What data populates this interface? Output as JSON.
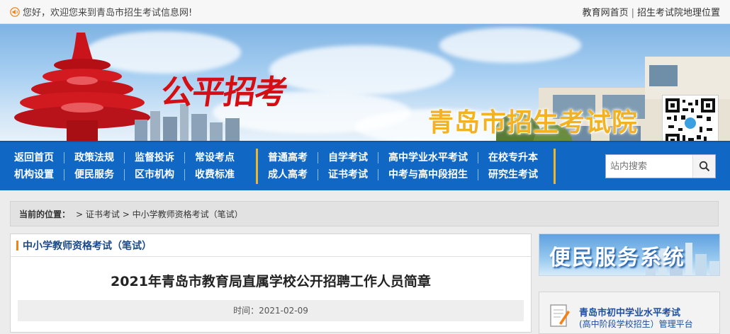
{
  "topbar": {
    "greeting": "您好，欢迎您来到青岛市招生考试信息网!",
    "link_home": "教育网首页",
    "separator": "|",
    "link_location": "招生考试院地理位置"
  },
  "banner": {
    "calligraphy": "公平招考",
    "title": "青岛市招生考试院"
  },
  "nav": {
    "group1": [
      "返回首页",
      "政策法规",
      "监督投诉",
      "常设考点",
      "机构设置",
      "便民服务",
      "区市机构",
      "收费标准"
    ],
    "group2": [
      "普通高考",
      "自学考试",
      "高中学业水平考试",
      "在校专升本",
      "成人高考",
      "证书考试",
      "中考与高中段招生",
      "研究生考试"
    ],
    "search_placeholder": "站内搜索"
  },
  "breadcrumb": {
    "label": "当前的位置：",
    "path": "> 证书考试 > 中小学教师资格考试（笔试）"
  },
  "article": {
    "section_title": "中小学教师资格考试（笔试）",
    "title": "2021年青岛市教育局直属学校公开招聘工作人员简章",
    "time": "时间：2021-02-09"
  },
  "sidebar": {
    "promo_title": "便民服务系统",
    "service_line1": "青岛市初中学业水平考试",
    "service_line2": "(高中阶段学校招生）管理平台"
  },
  "colors": {
    "nav_bg": "#1167c4",
    "accent_orange": "#f38117",
    "title_gold": "#f3b223",
    "calligraphy_red": "#d40f14"
  }
}
